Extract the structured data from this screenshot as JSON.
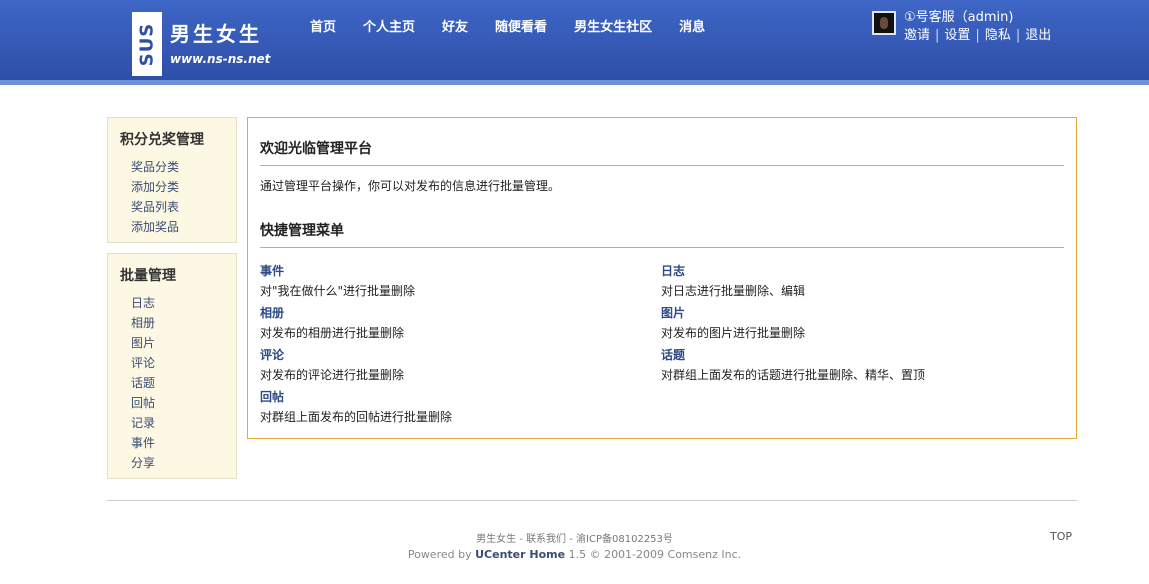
{
  "header": {
    "logo_badge": "SUS",
    "logo_title": "男生女生",
    "logo_url": "www.ns-ns.net",
    "nav": [
      "首页",
      "个人主页",
      "好友",
      "随便看看",
      "男生女生社区",
      "消息"
    ],
    "user_name": "①号客服（admin)",
    "user_links": [
      "邀请",
      "设置",
      "隐私",
      "退出"
    ]
  },
  "sidebar": {
    "reward": {
      "title": "积分兑奖管理",
      "items": [
        "奖品分类",
        "添加分类",
        "奖品列表",
        "添加奖品"
      ]
    },
    "batch": {
      "title": "批量管理",
      "items": [
        "日志",
        "相册",
        "图片",
        "评论",
        "话题",
        "回帖",
        "记录",
        "事件",
        "分享"
      ]
    }
  },
  "main": {
    "welcome_title": "欢迎光临管理平台",
    "intro": "通过管理平台操作，你可以对发布的信息进行批量管理。",
    "quick_title": "快捷管理菜单",
    "items": [
      {
        "title": "事件",
        "desc": "对\"我在做什么\"进行批量删除"
      },
      {
        "title": "日志",
        "desc": "对日志进行批量删除、编辑"
      },
      {
        "title": "相册",
        "desc": "对发布的相册进行批量删除"
      },
      {
        "title": "图片",
        "desc": "对发布的图片进行批量删除"
      },
      {
        "title": "评论",
        "desc": "对发布的评论进行批量删除"
      },
      {
        "title": "话题",
        "desc": "对群组上面发布的话题进行批量删除、精华、置顶"
      },
      {
        "title": "回帖",
        "desc": "对群组上面发布的回帖进行批量删除"
      }
    ]
  },
  "footer": {
    "site_name": "男生女生",
    "contact": "联系我们",
    "icp": "渝ICP备08102253号",
    "powered_prefix": "Powered by",
    "product": "UCenter Home",
    "version_copyright": "1.5 © 2001-2009 Comsenz Inc.",
    "top_label": "TOP"
  }
}
